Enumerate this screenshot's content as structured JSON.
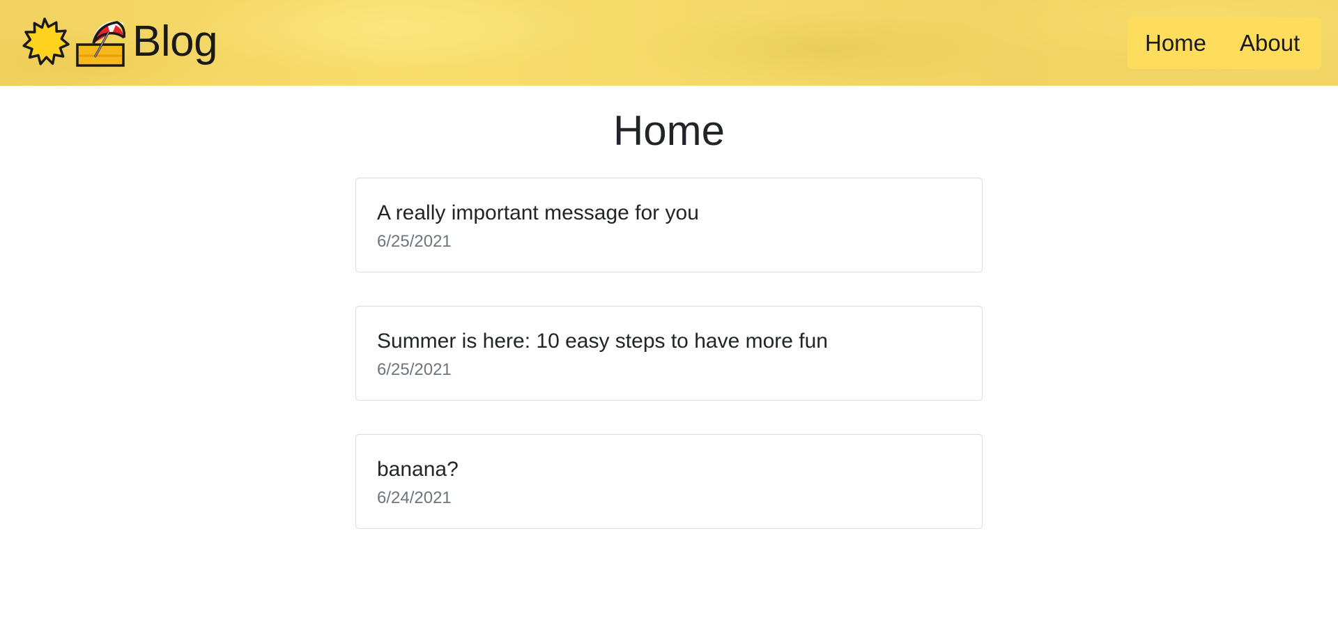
{
  "header": {
    "brand_title": "Blog",
    "brand_icons": [
      "sun-icon",
      "beach-umbrella-icon"
    ],
    "background_color": "#f4d863",
    "nav": {
      "background_color": "#fedd5c",
      "items": [
        {
          "label": "Home"
        },
        {
          "label": "About"
        }
      ]
    }
  },
  "main": {
    "page_title": "Home",
    "posts": [
      {
        "title": "A really important message for you",
        "date": "6/25/2021"
      },
      {
        "title": "Summer is here: 10 easy steps to have more fun",
        "date": "6/25/2021"
      },
      {
        "title": "banana?",
        "date": "6/24/2021"
      }
    ]
  }
}
